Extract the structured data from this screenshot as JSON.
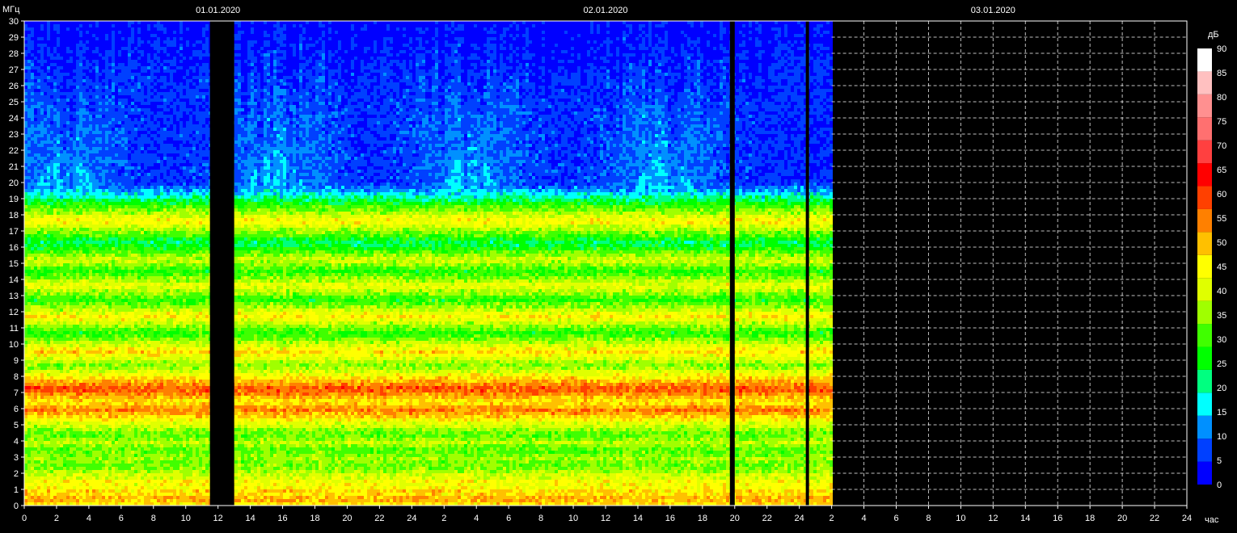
{
  "chart_data": {
    "type": "heatmap",
    "y_unit": "МГц",
    "x_unit": "час",
    "ylim": [
      0,
      30
    ],
    "y_ticks": [
      0,
      1,
      2,
      3,
      4,
      5,
      6,
      7,
      8,
      9,
      10,
      11,
      12,
      13,
      14,
      15,
      16,
      17,
      18,
      19,
      20,
      21,
      22,
      23,
      24,
      25,
      26,
      27,
      28,
      29,
      30
    ],
    "dates": [
      {
        "label": "01.01.2020",
        "hour": 12
      },
      {
        "label": "02.01.2020",
        "hour": 36
      },
      {
        "label": "03.01.2020",
        "hour": 60
      }
    ],
    "x_range_hours": [
      0,
      72
    ],
    "x_tick_labels": [
      "0",
      "2",
      "4",
      "6",
      "8",
      "10",
      "12",
      "14",
      "16",
      "18",
      "20",
      "22",
      "24",
      "2",
      "4",
      "6",
      "8",
      "10",
      "12",
      "14",
      "16",
      "18",
      "20",
      "22",
      "24",
      "2",
      "4",
      "6",
      "8",
      "10",
      "12",
      "14",
      "16",
      "18",
      "20",
      "22",
      "24"
    ],
    "data_end_hour": 50,
    "gaps_hours": [
      [
        11.5,
        13
      ],
      [
        43.7,
        44
      ],
      [
        48.4,
        48.6
      ]
    ],
    "grid": true,
    "colorbar": {
      "unit": "дБ",
      "levels": [
        0,
        5,
        10,
        15,
        20,
        25,
        30,
        35,
        40,
        45,
        50,
        55,
        60,
        65,
        70,
        75,
        80,
        85,
        90
      ],
      "colors": [
        "#0000ff",
        "#0040ff",
        "#0090ff",
        "#00ffff",
        "#00ff80",
        "#00ff00",
        "#40ff00",
        "#a0ff00",
        "#e0ff00",
        "#ffff00",
        "#ffc000",
        "#ff8000",
        "#ff4000",
        "#ff0000",
        "#ff4040",
        "#ff7070",
        "#ff9090",
        "#ffc0c0",
        "#ffffff"
      ]
    },
    "bands": [
      {
        "mhz": 0.5,
        "db": 55
      },
      {
        "mhz": 1.0,
        "db": 50
      },
      {
        "mhz": 1.5,
        "db": 48
      },
      {
        "mhz": 2.0,
        "db": 42
      },
      {
        "mhz": 3.0,
        "db": 38
      },
      {
        "mhz": 4.0,
        "db": 40
      },
      {
        "mhz": 5.0,
        "db": 40
      },
      {
        "mhz": 6.0,
        "db": 58
      },
      {
        "mhz": 7.3,
        "db": 62
      },
      {
        "mhz": 9.6,
        "db": 50
      },
      {
        "mhz": 11.8,
        "db": 48
      },
      {
        "mhz": 13.7,
        "db": 45
      },
      {
        "mhz": 15.3,
        "db": 42
      },
      {
        "mhz": 17.7,
        "db": 48
      }
    ],
    "activity_centers_hours": [
      2.5,
      15.5,
      27.5,
      39.5
    ]
  }
}
